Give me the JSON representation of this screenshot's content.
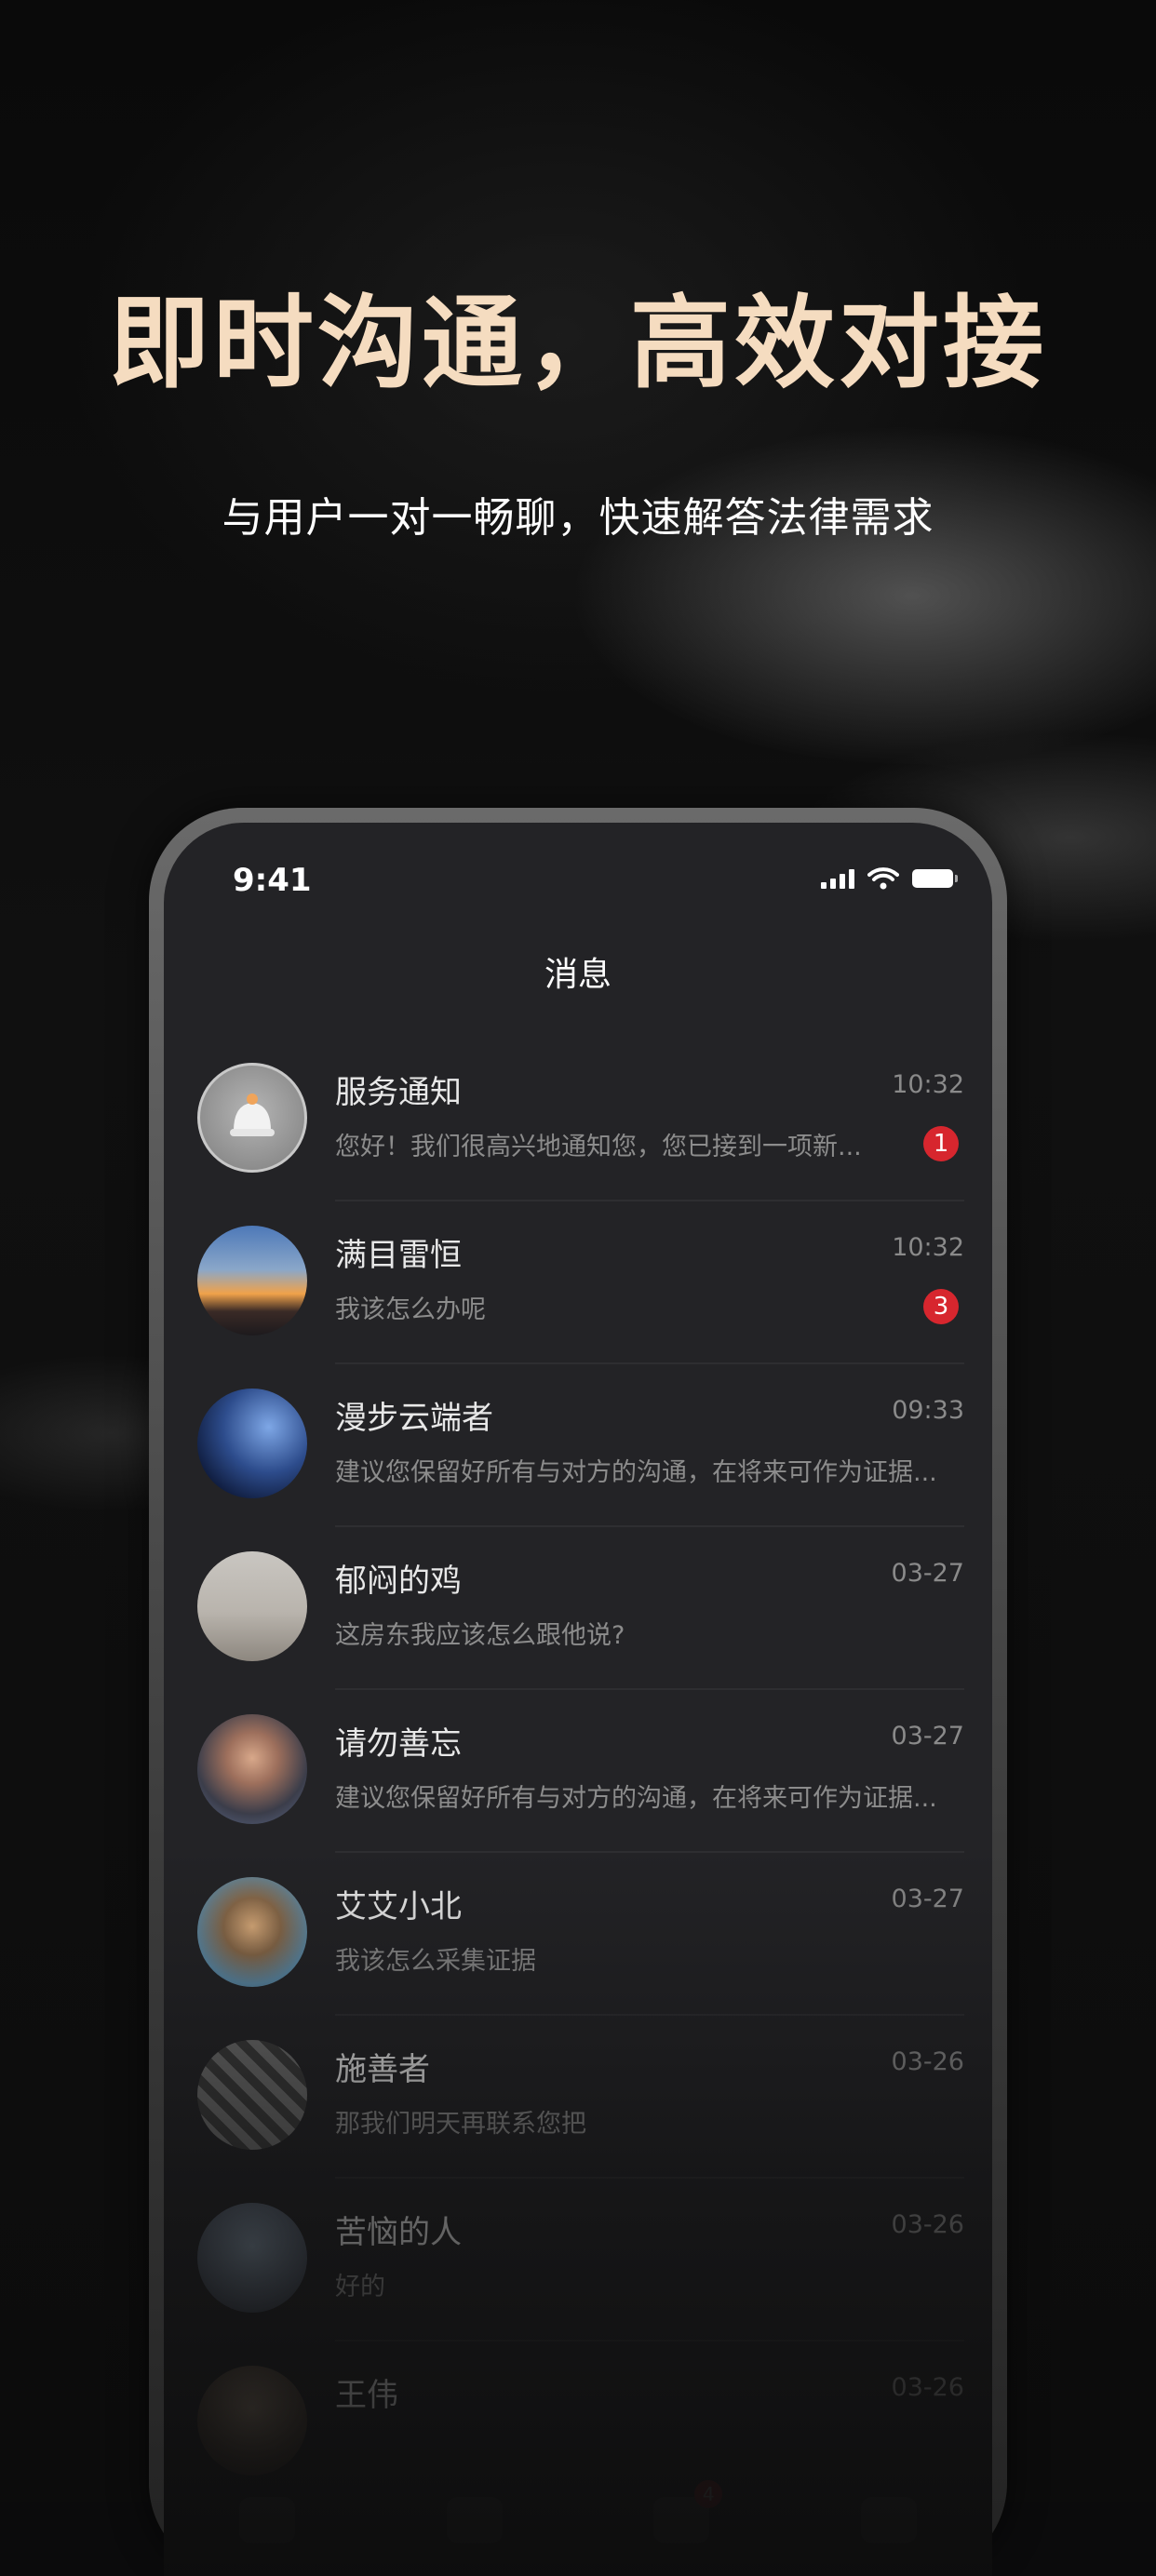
{
  "hero": {
    "title": "即时沟通，高效对接",
    "subtitle": "与用户一对一畅聊，快速解答法律需求"
  },
  "status_bar": {
    "time": "9:41"
  },
  "nav": {
    "title": "消息"
  },
  "messages": [
    {
      "name": "服务通知",
      "time": "10:32",
      "preview": "您好！我们很高兴地通知您，您已接到一项新...",
      "badge": "1"
    },
    {
      "name": "满目雷恒",
      "time": "10:32",
      "preview": "我该怎么办呢",
      "badge": "3"
    },
    {
      "name": "漫步云端者",
      "time": "09:33",
      "preview": "建议您保留好所有与对方的沟通，在将来可作为证据..."
    },
    {
      "name": "郁闷的鸡",
      "time": "03-27",
      "preview": "这房东我应该怎么跟他说?"
    },
    {
      "name": "请勿善忘",
      "time": "03-27",
      "preview": "建议您保留好所有与对方的沟通，在将来可作为证据..."
    },
    {
      "name": "艾艾小北",
      "time": "03-27",
      "preview": "我该怎么采集证据"
    },
    {
      "name": "施善者",
      "time": "03-26",
      "preview": "那我们明天再联系您把"
    },
    {
      "name": "苦恼的人",
      "time": "03-26",
      "preview": "好的"
    },
    {
      "name": "王伟",
      "time": "03-26",
      "preview": ""
    }
  ],
  "tabbar": {
    "message_badge": "4"
  },
  "colors": {
    "title_gold": "#f5dcc0",
    "badge_red": "#d7262e",
    "screen_bg": "#232326"
  }
}
